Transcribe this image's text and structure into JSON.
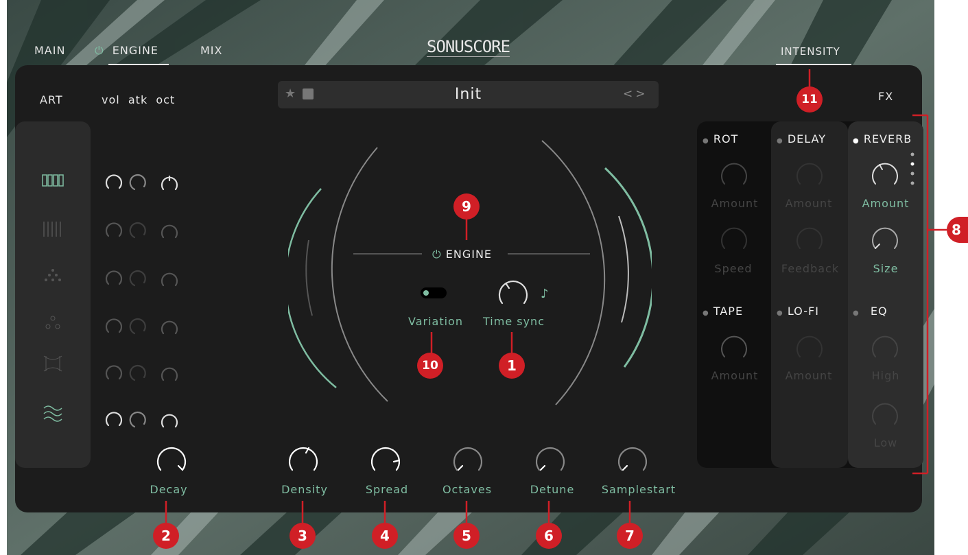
{
  "nav": {
    "main": "MAIN",
    "engine": "ENGINE",
    "mix": "MIX",
    "intensity": "INTENSITY"
  },
  "logo": "SONUSCORE",
  "left": {
    "art": "ART",
    "cols": "vol  atk  oct"
  },
  "preset": {
    "name": "Init"
  },
  "fx_header": "FX",
  "engine": {
    "title": "ENGINE",
    "variation": "Variation",
    "timesync": "Time sync"
  },
  "knobs": {
    "decay": "Decay",
    "density": "Density",
    "spread": "Spread",
    "octaves": "Octaves",
    "detune": "Detune",
    "samplestart": "Samplestart"
  },
  "fx": {
    "rot": {
      "title": "ROT",
      "k1": "Amount",
      "k2": "Speed"
    },
    "delay": {
      "title": "DELAY",
      "k1": "Amount",
      "k2": "Feedback"
    },
    "reverb": {
      "title": "REVERB",
      "k1": "Amount",
      "k2": "Size"
    },
    "tape": {
      "title": "TAPE",
      "k1": "Amount"
    },
    "lofi": {
      "title": "LO-FI",
      "k1": "Amount"
    },
    "eq": {
      "title": "EQ",
      "k1": "High",
      "k2": "Low"
    }
  },
  "badges": {
    "b1": "1",
    "b2": "2",
    "b3": "3",
    "b4": "4",
    "b5": "5",
    "b6": "6",
    "b7": "7",
    "b8": "8",
    "b9": "9",
    "b10": "10",
    "b11": "11"
  },
  "colors": {
    "accent": "#7fbda2",
    "badge": "#d01f26",
    "panel": "#1c1c1c"
  }
}
